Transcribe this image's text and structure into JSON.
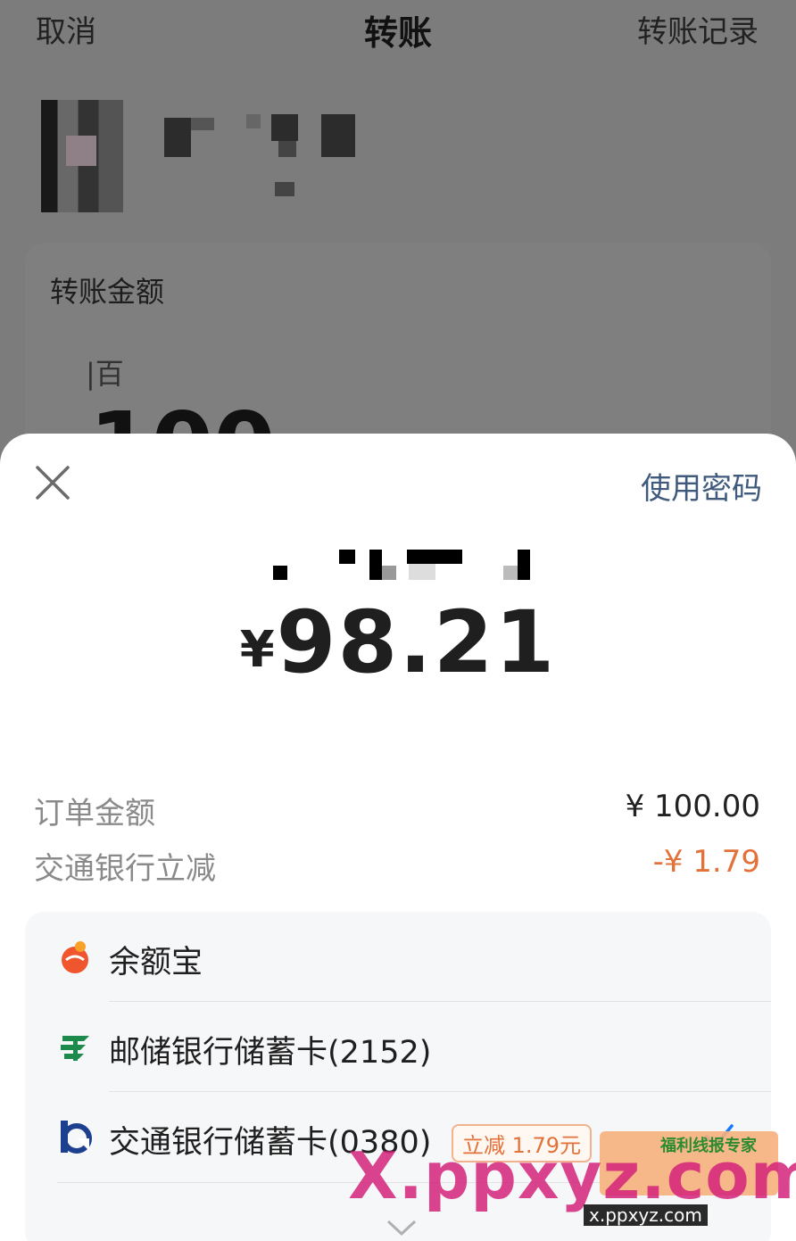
{
  "nav": {
    "cancel": "取消",
    "title": "转账",
    "history": "转账记录"
  },
  "transfer": {
    "amount_label": "转账金额",
    "unit_hint": "|百",
    "amount_partial": "100"
  },
  "sheet": {
    "use_password": "使用密码",
    "currency": "¥",
    "pay_amount": "98.21",
    "order_label": "订单金额",
    "order_value": "¥ 100.00",
    "discount_label": "交通银行立减",
    "discount_value": "-¥ 1.79",
    "methods": [
      {
        "label": "余额宝",
        "icon": "yuebao-icon"
      },
      {
        "label": "邮储银行储蓄卡(2152)",
        "icon": "psbc-icon"
      },
      {
        "label": "交通银行储蓄卡(0380)",
        "icon": "bocom-icon",
        "promo": "立减 1.79元",
        "selected": true
      }
    ]
  },
  "watermark": {
    "logo": "X.ppxyz.com",
    "brand": "福利线报专家",
    "url": "x.ppxyz.com"
  },
  "colors": {
    "accent_link": "#3f5a7c",
    "discount": "#e2713a",
    "selected_check": "#1677ff"
  }
}
